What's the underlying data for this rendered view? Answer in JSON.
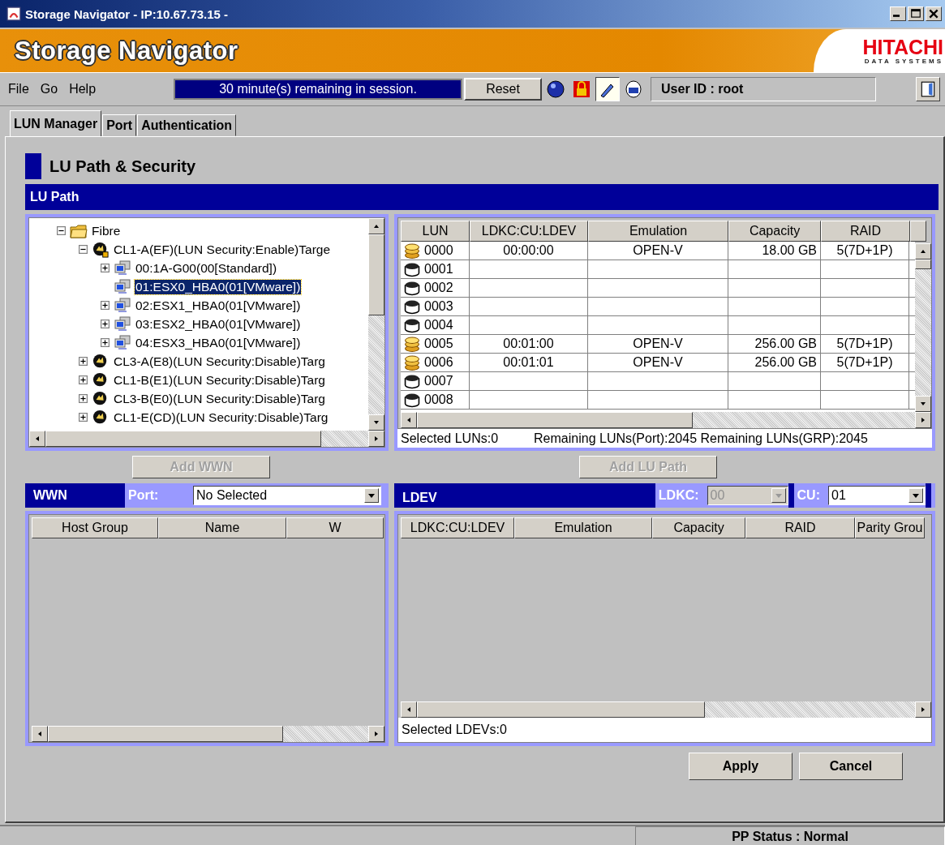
{
  "window": {
    "title": "Storage Navigator - IP:10.67.73.15 -"
  },
  "banner": {
    "title": "Storage Navigator",
    "brand": "HITACHI",
    "brand_sub": "DATA SYSTEMS"
  },
  "menu": [
    {
      "label": "File"
    },
    {
      "label": "Go"
    },
    {
      "label": "Help"
    }
  ],
  "session": {
    "message": "30 minute(s) remaining in session.",
    "reset": "Reset"
  },
  "toolbar": [
    {
      "kind": "globe",
      "pressed": false
    },
    {
      "kind": "lock",
      "pressed": false
    },
    {
      "kind": "pen",
      "pressed": true
    },
    {
      "kind": "disk",
      "pressed": false
    }
  ],
  "user": "User ID : root",
  "tabs": [
    {
      "label": "LUN Manager",
      "selected": true
    },
    {
      "label": "Port",
      "selected": false
    },
    {
      "label": "Authentication",
      "selected": false
    }
  ],
  "heading": "LU Path & Security",
  "lu_path": {
    "title": "LU Path",
    "tree": [
      {
        "kind": "folder",
        "label": "Fibre",
        "expanded": true,
        "selected": false,
        "children": [
          {
            "kind": "port-secure",
            "label": "CL1-A(EF)(LUN Security:Enable)Targe",
            "expanded": true,
            "selected": false,
            "children": [
              {
                "kind": "host",
                "label": "00:1A-G00(00[Standard])",
                "expanded": false,
                "selected": false
              },
              {
                "kind": "host",
                "label": "01:ESX0_HBA0(01[VMware])",
                "selected": true
              },
              {
                "kind": "host",
                "label": "02:ESX1_HBA0(01[VMware])",
                "expanded": false,
                "selected": false
              },
              {
                "kind": "host",
                "label": "03:ESX2_HBA0(01[VMware])",
                "expanded": false,
                "selected": false
              },
              {
                "kind": "host",
                "label": "04:ESX3_HBA0(01[VMware])",
                "expanded": false,
                "selected": false
              }
            ]
          },
          {
            "kind": "port",
            "label": "CL3-A(E8)(LUN Security:Disable)Targ",
            "expanded": false,
            "selected": false
          },
          {
            "kind": "port",
            "label": "CL1-B(E1)(LUN Security:Disable)Targ",
            "expanded": false,
            "selected": false
          },
          {
            "kind": "port",
            "label": "CL3-B(E0)(LUN Security:Disable)Targ",
            "expanded": false,
            "selected": false
          },
          {
            "kind": "port",
            "label": "CL1-E(CD)(LUN Security:Disable)Targ",
            "expanded": false,
            "selected": false
          }
        ]
      }
    ],
    "lun_table": {
      "columns": [
        "LUN",
        "LDKC:CU:LDEV",
        "Emulation",
        "Capacity",
        "RAID"
      ],
      "rows": [
        {
          "kind": "mapped",
          "lun": "0000",
          "ldev": "00:00:00",
          "emulation": "OPEN-V",
          "capacity": "18.00 GB",
          "raid": "5(7D+1P)"
        },
        {
          "kind": "free",
          "lun": "0001"
        },
        {
          "kind": "free",
          "lun": "0002"
        },
        {
          "kind": "free",
          "lun": "0003"
        },
        {
          "kind": "free",
          "lun": "0004"
        },
        {
          "kind": "mapped",
          "lun": "0005",
          "ldev": "00:01:00",
          "emulation": "OPEN-V",
          "capacity": "256.00 GB",
          "raid": "5(7D+1P)"
        },
        {
          "kind": "mapped",
          "lun": "0006",
          "ldev": "00:01:01",
          "emulation": "OPEN-V",
          "capacity": "256.00 GB",
          "raid": "5(7D+1P)"
        },
        {
          "kind": "free",
          "lun": "0007"
        },
        {
          "kind": "free",
          "lun": "0008"
        }
      ]
    },
    "selected_luns": "Selected LUNs:0",
    "remaining": "Remaining LUNs(Port):2045 Remaining LUNs(GRP):2045"
  },
  "buttons": [
    {
      "label": "Add WWN",
      "disabled": true
    },
    {
      "label": "Add LU Path",
      "disabled": true
    }
  ],
  "wwn": {
    "title": "WWN",
    "port_label": "Port:",
    "port_value": "No Selected",
    "columns": [
      "Host Group",
      "Name",
      "W"
    ]
  },
  "ldev": {
    "title": "LDEV",
    "ldkc_label": "LDKC:",
    "ldkc_value": "00",
    "ldkc_disabled": true,
    "cu_label": "CU:",
    "cu_value": "01",
    "cu_disabled": false,
    "columns": [
      "LDKC:CU:LDEV",
      "Emulation",
      "Capacity",
      "RAID",
      "Parity Grou"
    ],
    "status": "Selected LDEVs:0"
  },
  "actions": [
    {
      "label": "Apply"
    },
    {
      "label": "Cancel"
    }
  ],
  "status_bar": "PP Status : Normal"
}
